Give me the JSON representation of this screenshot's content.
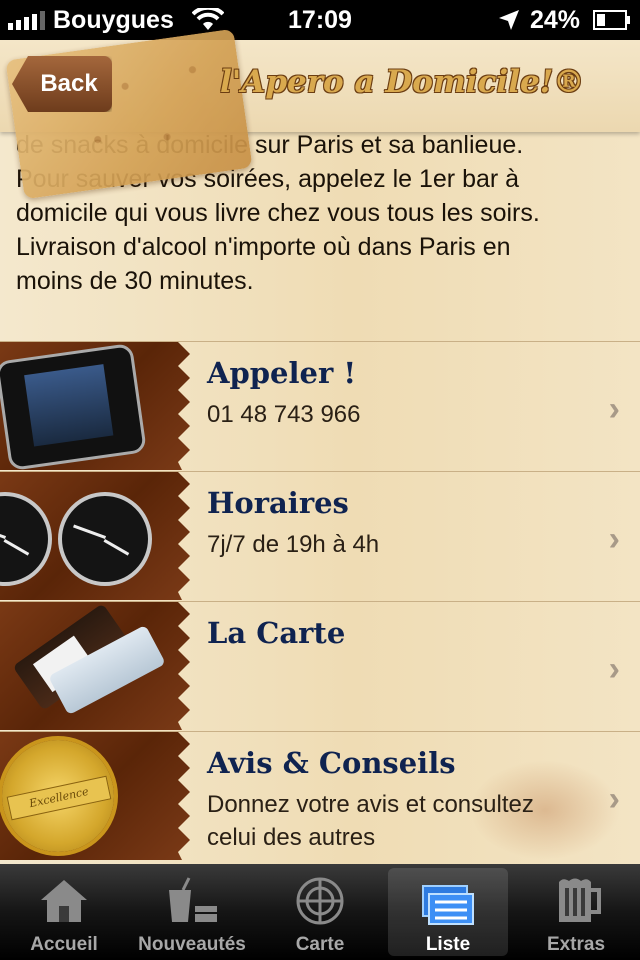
{
  "status_bar": {
    "carrier": "Bouygues",
    "time": "17:09",
    "battery": "24%"
  },
  "header": {
    "back_label": "Back",
    "logo_text": "l'Apero a Domicile!®"
  },
  "intro": {
    "lines": [
      "de snacks à domicile sur Paris et sa banlieue.",
      "Pour sauver vos soirées, appelez le 1er bar à",
      "domicile qui vous livre chez vous tous les soirs.",
      "Livraison d'alcool n'importe où dans Paris en",
      "moins de 30 minutes."
    ]
  },
  "list": {
    "items": [
      {
        "title": "Appeler !",
        "subtitle": "01 48 743 966",
        "image": "phone-image"
      },
      {
        "title": "Horaires",
        "subtitle": "7j/7 de 19h à 4h",
        "image": "clocks-image"
      },
      {
        "title": "La Carte",
        "subtitle": "",
        "image": "bottles-image"
      },
      {
        "title": "Avis & Conseils",
        "subtitle": "Donnez votre avis et consultez celui des autres",
        "image": "excellence-seal-image"
      }
    ]
  },
  "tabbar": {
    "tabs": [
      {
        "label": "Accueil",
        "icon": "home-icon",
        "selected": false
      },
      {
        "label": "Nouveautés",
        "icon": "drinks-icon",
        "selected": false
      },
      {
        "label": "Carte",
        "icon": "radar-icon",
        "selected": false
      },
      {
        "label": "Liste",
        "icon": "list-icon",
        "selected": true
      },
      {
        "label": "Extras",
        "icon": "beer-mug-icon",
        "selected": false
      }
    ]
  },
  "colors": {
    "title_blue": "#0f2350",
    "wood_brown": "#6e3c1c",
    "parchment": "#f1e3c4"
  }
}
